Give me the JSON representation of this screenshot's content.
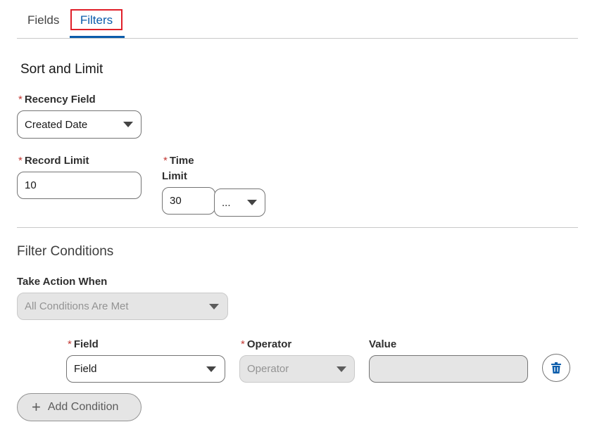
{
  "tabs": {
    "fields": "Fields",
    "filters": "Filters"
  },
  "sort_limit": {
    "title": "Sort and Limit",
    "recency": {
      "required": "*",
      "label": "Recency Field",
      "value": "Created Date"
    },
    "record_limit": {
      "required": "*",
      "label": "Record Limit",
      "value": "10"
    },
    "time_limit": {
      "required": "*",
      "label_line1": "Time",
      "label_line2": "Limit",
      "value": "30",
      "unit": "..."
    }
  },
  "filter_conditions": {
    "title": "Filter Conditions",
    "take_action": {
      "label": "Take Action When",
      "value": "All Conditions Are Met"
    },
    "row": {
      "field": {
        "required": "*",
        "label": "Field",
        "value": "Field"
      },
      "operator": {
        "required": "*",
        "label": "Operator",
        "placeholder": "Operator"
      },
      "value": {
        "label": "Value"
      }
    },
    "add_condition": "Add Condition"
  },
  "colors": {
    "accent": "#0b5cab",
    "required": "#c23934",
    "highlight": "#e0202a"
  },
  "icons": {
    "delete": "trash-icon",
    "add": "plus-icon",
    "dropdown": "chevron-down-icon"
  }
}
